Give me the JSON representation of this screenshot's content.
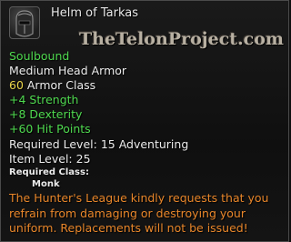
{
  "item": {
    "icon": "helmet-icon",
    "name": "Helm of Tarkas",
    "watermark": "TheTelonProject.com",
    "binding": "Soulbound",
    "type": "Medium Head Armor",
    "armor_class_value": "60",
    "armor_class_label": " Armor Class",
    "stats": [
      "+4 Strength",
      "+8 Dexterity",
      "+60 Hit Points"
    ],
    "required_level_label": "Required Level:",
    "required_level_value": "15 Adventuring",
    "item_level_label": "Item Level:",
    "item_level_value": "25",
    "required_class_label": "Required Class:",
    "required_class_value": "Monk",
    "description": "The Hunter's League kindly requests that you refrain from damaging or destroying your uniform. Replacements will not be issued!"
  },
  "colors": {
    "stat_green": "#4fd94f",
    "binding_green": "#4fd94f",
    "armor_yellow": "#e9d44a",
    "description_orange": "#e8862a",
    "text_white": "#ececec"
  }
}
